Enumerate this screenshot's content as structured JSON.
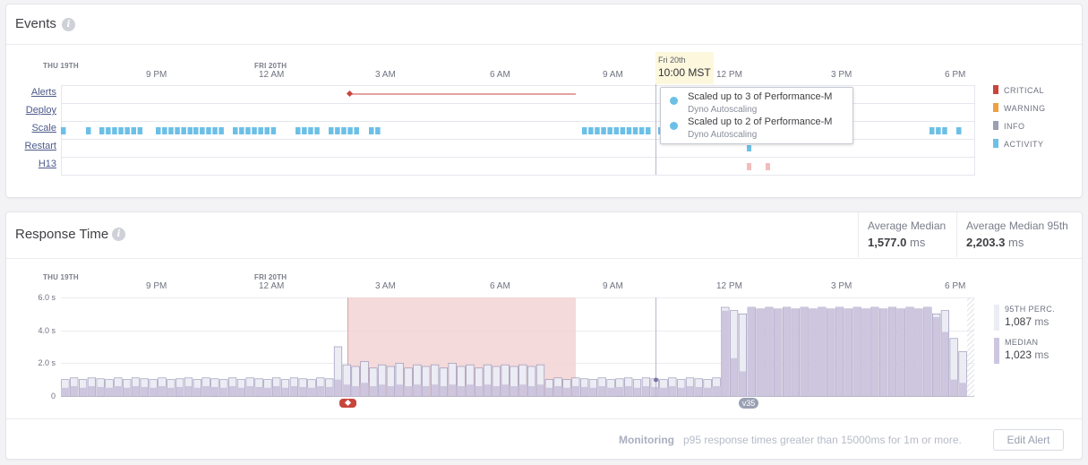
{
  "events": {
    "title": "Events",
    "info_icon": "info-icon",
    "day_labels": [
      "THU 19TH",
      "FRI 20TH"
    ],
    "time_labels": [
      "9 PM",
      "12 AM",
      "3 AM",
      "6 AM",
      "9 AM",
      "12 PM",
      "3 PM",
      "6 PM"
    ],
    "rows": [
      "Alerts",
      "Deploy",
      "Scale",
      "Restart",
      "H13"
    ],
    "legend": [
      {
        "label": "CRITICAL",
        "color": "#c9453c"
      },
      {
        "label": "WARNING",
        "color": "#f0a040"
      },
      {
        "label": "INFO",
        "color": "#9aa0b2"
      },
      {
        "label": "ACTIVITY",
        "color": "#6cc0e8"
      }
    ],
    "cursor": {
      "date": "Fri 20th",
      "time": "10:00 MST"
    },
    "tooltip": [
      {
        "title": "Scaled up to 3 of Performance-M",
        "subtitle": "Dyno Autoscaling"
      },
      {
        "title": "Scaled up to 2 of Performance-M",
        "subtitle": "Dyno Autoscaling"
      }
    ]
  },
  "response_time": {
    "title": "Response Time",
    "info_icon": "info-icon",
    "average_median": {
      "label": "Average Median",
      "value": "1,577.0",
      "unit": "ms"
    },
    "average_median_95": {
      "label": "Average Median 95th",
      "value": "2,203.3",
      "unit": "ms"
    },
    "day_labels": [
      "THU 19TH",
      "FRI 20TH"
    ],
    "time_labels": [
      "9 PM",
      "12 AM",
      "3 AM",
      "6 AM",
      "9 AM",
      "12 PM",
      "3 PM",
      "6 PM"
    ],
    "y_labels": [
      "6.0 s",
      "4.0 s",
      "2.0 s",
      "0"
    ],
    "legend": [
      {
        "label": "95TH PERC.",
        "value": "1,087",
        "unit": "ms",
        "color": "#ececf4"
      },
      {
        "label": "MEDIAN",
        "value": "1,023",
        "unit": "ms",
        "color": "#cdc6de"
      }
    ],
    "release_badge": "v35",
    "monitoring": {
      "label": "Monitoring",
      "text": "p95 response times greater than 15000ms for 1m or more."
    },
    "edit_alert_label": "Edit Alert"
  },
  "chart_data": {
    "type": "bar",
    "ylabel": "",
    "ylim": [
      0,
      6
    ],
    "y_unit": "s",
    "series": [
      {
        "name": "95TH PERC.",
        "values": [
          1.0,
          1.1,
          1.0,
          1.1,
          1.05,
          1.0,
          1.1,
          1.0,
          1.1,
          1.05,
          1.0,
          1.1,
          1.0,
          1.05,
          1.1,
          1.0,
          1.1,
          1.05,
          1.0,
          1.1,
          1.0,
          1.1,
          1.05,
          1.0,
          1.1,
          1.0,
          1.1,
          1.05,
          1.0,
          1.1,
          1.05,
          3.0,
          1.9,
          1.8,
          2.1,
          1.7,
          1.9,
          1.8,
          2.0,
          1.7,
          1.9,
          1.8,
          1.9,
          1.7,
          2.0,
          1.8,
          1.9,
          1.7,
          1.9,
          1.8,
          1.9,
          1.8,
          1.9,
          1.8,
          1.9,
          1.0,
          1.1,
          1.0,
          1.1,
          1.05,
          1.0,
          1.1,
          1.0,
          1.05,
          1.1,
          1.0,
          1.1,
          1.05,
          1.0,
          1.1,
          1.0,
          1.1,
          1.05,
          1.0,
          1.1,
          5.4,
          5.2,
          5.0,
          5.4,
          5.3,
          5.4,
          5.3,
          5.4,
          5.3,
          5.4,
          5.3,
          5.4,
          5.3,
          5.4,
          5.3,
          5.4,
          5.3,
          5.4,
          5.3,
          5.4,
          5.3,
          5.4,
          5.3,
          5.4,
          5.0,
          5.2,
          3.5,
          2.7
        ]
      },
      {
        "name": "MEDIAN",
        "values": [
          0.5,
          0.6,
          0.5,
          0.6,
          0.55,
          0.5,
          0.6,
          0.5,
          0.6,
          0.55,
          0.5,
          0.6,
          0.5,
          0.55,
          0.6,
          0.5,
          0.6,
          0.55,
          0.5,
          0.6,
          0.5,
          0.6,
          0.55,
          0.5,
          0.6,
          0.5,
          0.6,
          0.55,
          0.5,
          0.6,
          0.55,
          1.0,
          0.7,
          0.6,
          0.8,
          0.6,
          0.7,
          0.6,
          0.7,
          0.6,
          0.7,
          0.6,
          0.7,
          0.6,
          0.7,
          0.6,
          0.7,
          0.6,
          0.7,
          0.6,
          0.7,
          0.6,
          0.7,
          0.6,
          0.7,
          0.5,
          0.6,
          0.5,
          0.6,
          0.55,
          0.5,
          0.6,
          0.5,
          0.55,
          0.6,
          0.5,
          0.6,
          0.55,
          0.5,
          0.6,
          0.5,
          0.6,
          0.55,
          0.5,
          0.6,
          5.2,
          2.3,
          1.5,
          5.4,
          5.3,
          5.4,
          5.3,
          5.4,
          5.3,
          5.4,
          5.3,
          5.4,
          5.3,
          5.4,
          5.3,
          5.4,
          5.3,
          5.4,
          5.3,
          5.4,
          5.3,
          5.4,
          5.3,
          5.4,
          4.8,
          3.9,
          1.0,
          0.8
        ]
      }
    ]
  }
}
